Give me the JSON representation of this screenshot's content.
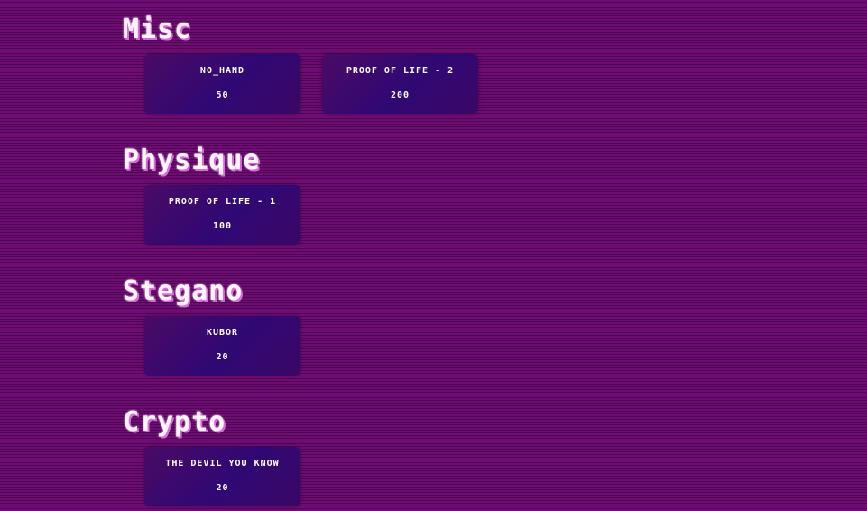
{
  "categories": [
    {
      "title": "Misc",
      "challenges": [
        {
          "name": "NO_HAND",
          "points": "50"
        },
        {
          "name": "PROOF OF LIFE - 2",
          "points": "200"
        }
      ]
    },
    {
      "title": "Physique",
      "challenges": [
        {
          "name": "PROOF OF LIFE - 1",
          "points": "100"
        }
      ]
    },
    {
      "title": "Stegano",
      "challenges": [
        {
          "name": "KUBOR",
          "points": "20"
        }
      ]
    },
    {
      "title": "Crypto",
      "challenges": [
        {
          "name": "THE DEVIL YOU KNOW",
          "points": "20"
        }
      ]
    }
  ]
}
